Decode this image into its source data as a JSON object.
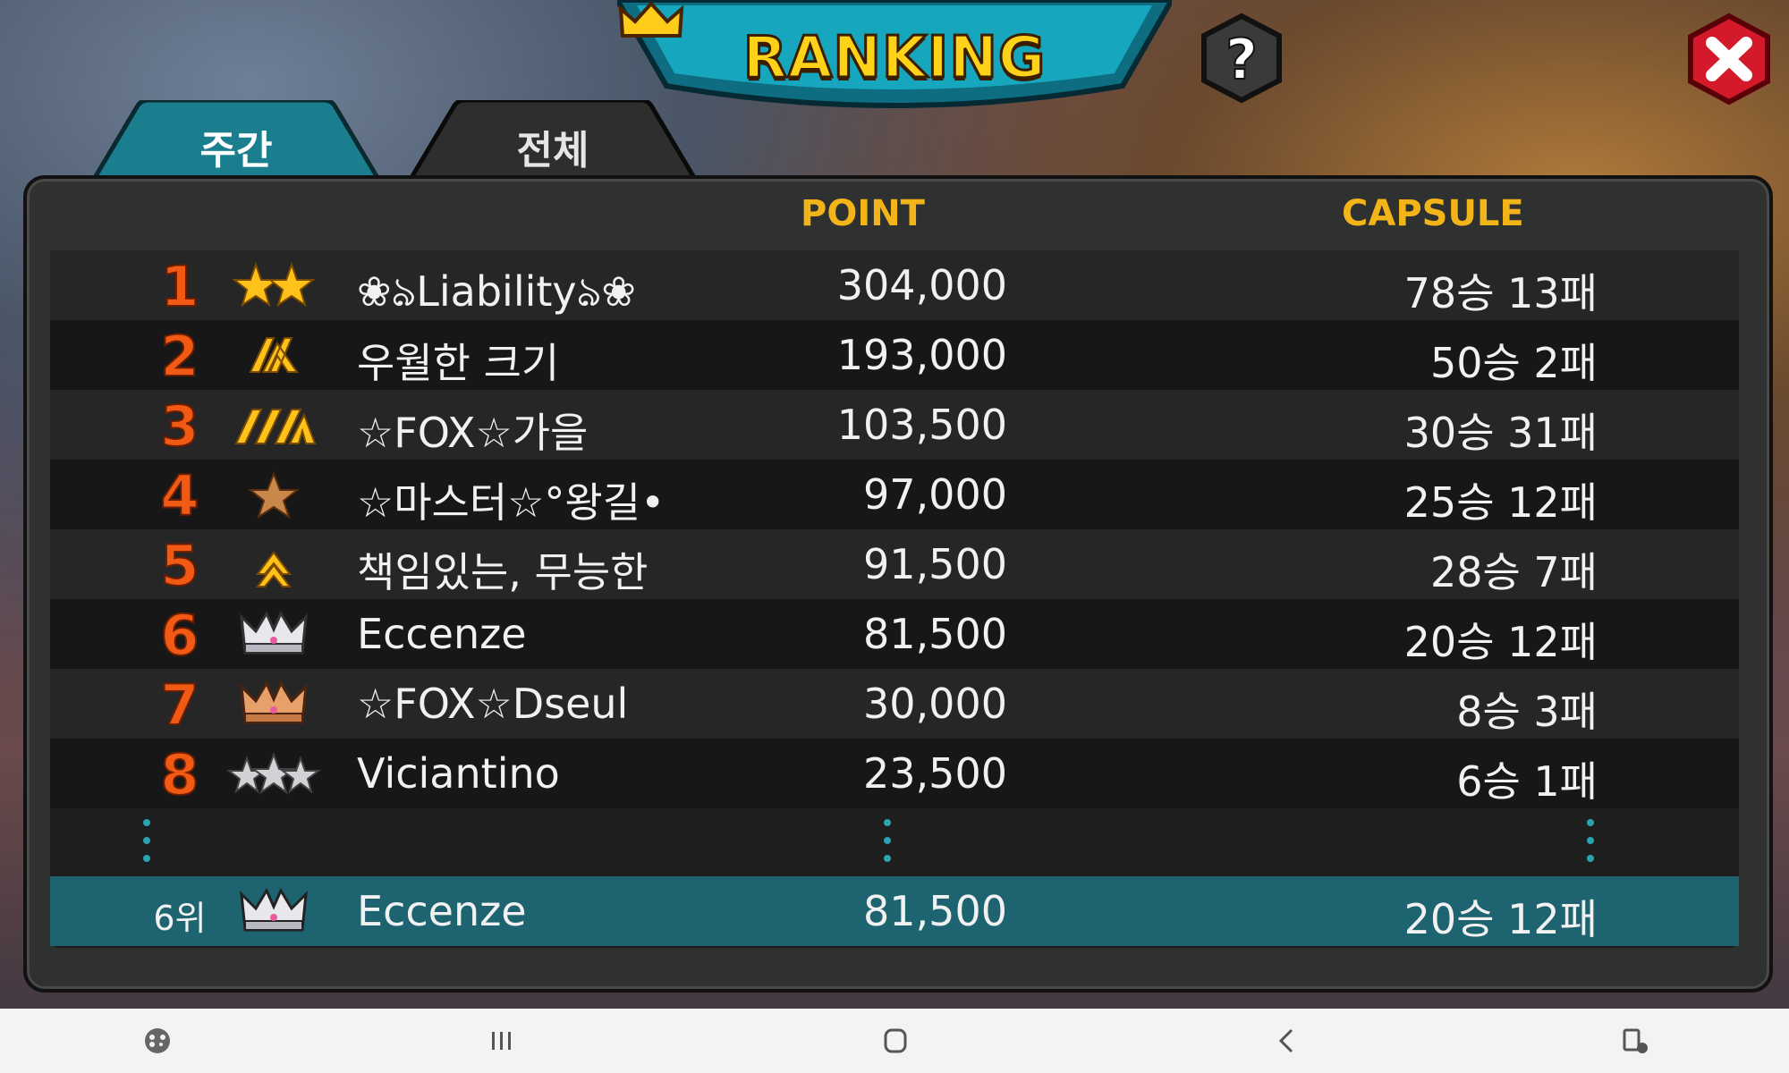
{
  "header": {
    "title": "RANKING"
  },
  "tabs": [
    {
      "label": "주간",
      "active": true
    },
    {
      "label": "전체",
      "active": false
    }
  ],
  "columns": {
    "point": "POINT",
    "capsule": "CAPSULE"
  },
  "rows": [
    {
      "rank": "1",
      "badge": "two-gold-stars-icon",
      "name": "❀ঌLiabilityঌ❀",
      "point": "304,000",
      "capsule": "78승 13패"
    },
    {
      "rank": "2",
      "badge": "double-gold-chevron-icon",
      "name": "우월한 크기",
      "point": "193,000",
      "capsule": "50승 2패"
    },
    {
      "rank": "3",
      "badge": "triple-gold-chevron-icon",
      "name": "☆FOX☆가을",
      "point": "103,500",
      "capsule": "30승 31패"
    },
    {
      "rank": "4",
      "badge": "bronze-star-icon",
      "name": "☆마스터☆°왕길•",
      "point": "97,000",
      "capsule": "25승 12패"
    },
    {
      "rank": "5",
      "badge": "single-gold-chevron-icon",
      "name": "책임있는, 무능한",
      "point": "91,500",
      "capsule": "28승 7패"
    },
    {
      "rank": "6",
      "badge": "silver-crown-icon",
      "name": "Eccenze",
      "point": "81,500",
      "capsule": "20승 12패"
    },
    {
      "rank": "7",
      "badge": "bronze-crown-icon",
      "name": "☆FOX☆Dseul",
      "point": "30,000",
      "capsule": "8승 3패"
    },
    {
      "rank": "8",
      "badge": "three-silver-stars-icon",
      "name": "Viciantino",
      "point": "23,500",
      "capsule": "6승 1패"
    }
  ],
  "my_rank": {
    "rank": "6위",
    "badge": "silver-crown-icon",
    "name": "Eccenze",
    "point": "81,500",
    "capsule": "20승 12패"
  },
  "colors": {
    "accent_teal": "#1d6470",
    "gold": "#f2b418",
    "rank_orange": "#f05a14"
  },
  "nav_icons": [
    "game-launcher-icon",
    "recent-apps-icon",
    "home-icon",
    "back-icon",
    "screen-rotate-icon"
  ]
}
